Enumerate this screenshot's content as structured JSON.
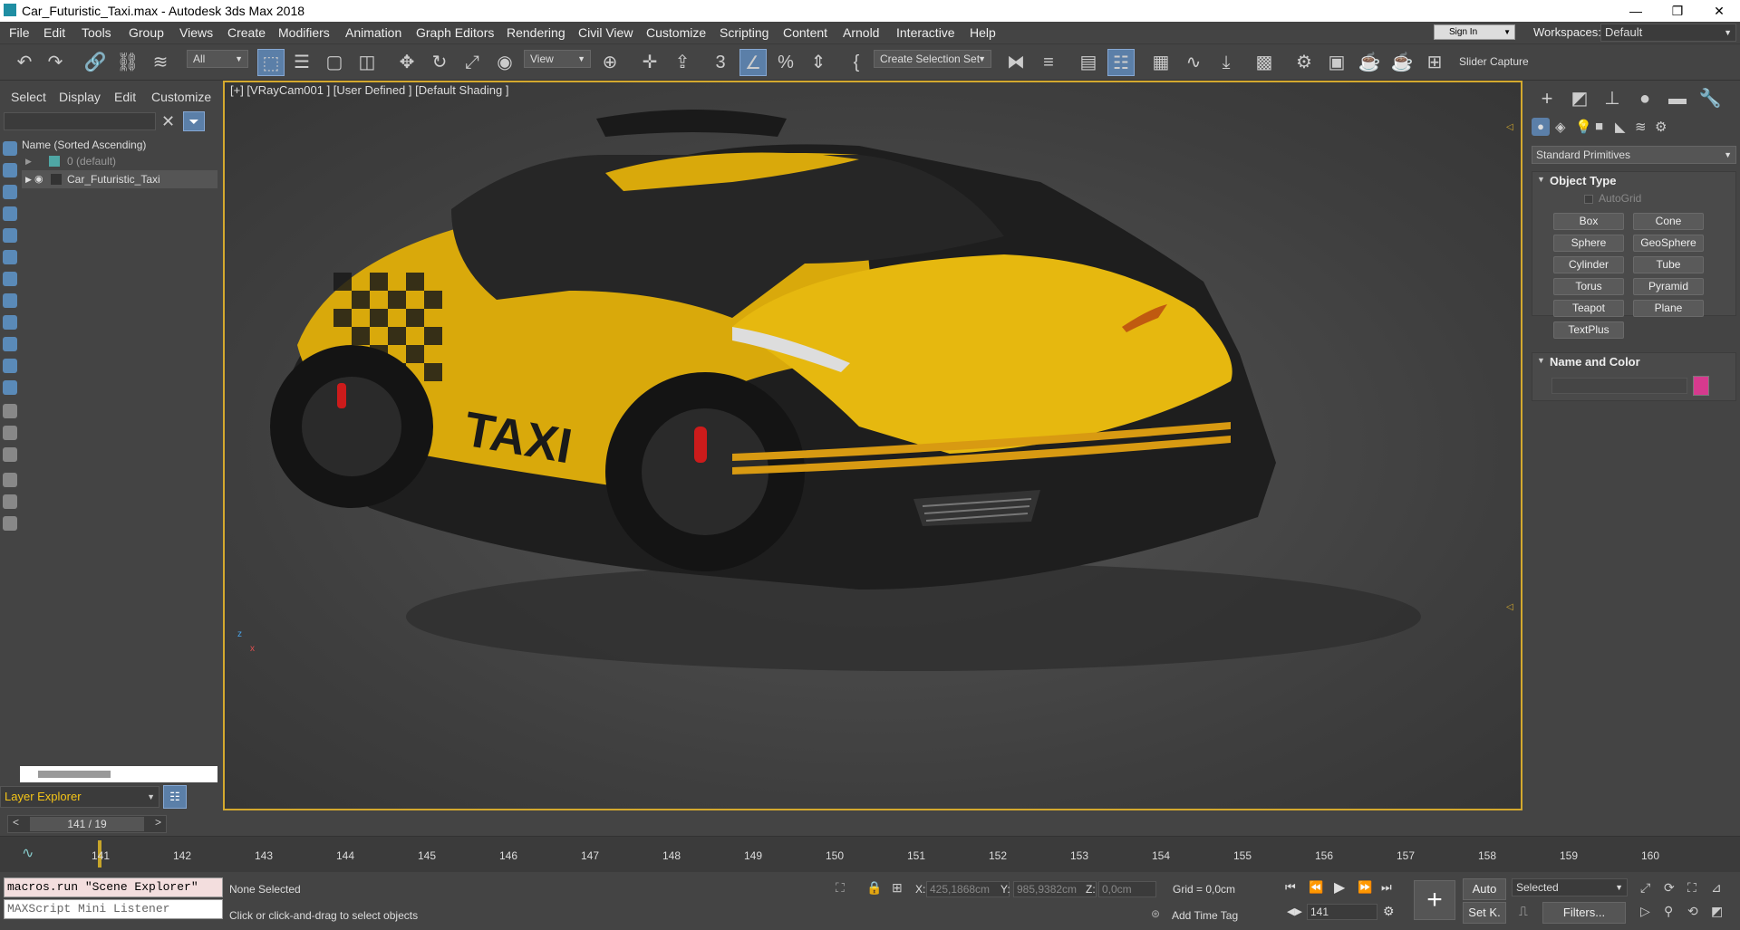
{
  "window": {
    "title": "Car_Futuristic_Taxi.max - Autodesk 3ds Max 2018",
    "minimize": "—",
    "maximize": "❐",
    "close": "✕"
  },
  "menu": [
    "File",
    "Edit",
    "Tools",
    "Group",
    "Views",
    "Create",
    "Modifiers",
    "Animation",
    "Graph Editors",
    "Rendering",
    "Civil View",
    "Customize",
    "Scripting",
    "Content",
    "Arnold",
    "Interactive",
    "Help"
  ],
  "signin": "Sign In",
  "workspaces": {
    "label": "Workspaces:",
    "value": "Default"
  },
  "toolbar": {
    "filter": "All",
    "view": "View",
    "selection_set": "Create Selection Set",
    "slider_capture": "Slider Capture"
  },
  "left_panel": {
    "tabs": [
      "Select",
      "Display",
      "Edit",
      "Customize"
    ],
    "tree_header": "Name (Sorted Ascending)",
    "rows": [
      {
        "label": "0 (default)"
      },
      {
        "label": "Car_Futuristic_Taxi"
      }
    ],
    "layer_explorer": "Layer Explorer"
  },
  "viewport": {
    "label": "[+] [VRayCam001 ] [User Defined ] [Default Shading ]",
    "car_text": "TAXI"
  },
  "right_panel": {
    "category": "Standard Primitives",
    "object_type_title": "Object Type",
    "autogrid": "AutoGrid",
    "buttons": [
      "Box",
      "Cone",
      "Sphere",
      "GeoSphere",
      "Cylinder",
      "Tube",
      "Torus",
      "Pyramid",
      "Teapot",
      "Plane",
      "TextPlus"
    ],
    "name_color_title": "Name and Color",
    "swatch_color": "#d63a8e"
  },
  "timeline": {
    "frame_display": "141 / 19",
    "ticks": [
      "141",
      "142",
      "143",
      "144",
      "145",
      "146",
      "147",
      "148",
      "149",
      "150",
      "151",
      "152",
      "153",
      "154",
      "155",
      "156",
      "157",
      "158",
      "159",
      "160"
    ]
  },
  "status": {
    "maxscript_line1": "macros.run \"Scene Explorer\"",
    "maxscript_line2": "MAXScript Mini Listener",
    "selection": "None Selected",
    "prompt": "Click or click-and-drag to select objects",
    "x_label": "X:",
    "x_value": "425,1868cm",
    "y_label": "Y:",
    "y_value": "985,9382cm",
    "z_label": "Z:",
    "z_value": "0,0cm",
    "grid": "Grid = 0,0cm",
    "add_time_tag": "Add Time Tag",
    "auto": "Auto",
    "selected": "Selected",
    "current_frame": "141",
    "setk": "Set K.",
    "filters": "Filters..."
  }
}
